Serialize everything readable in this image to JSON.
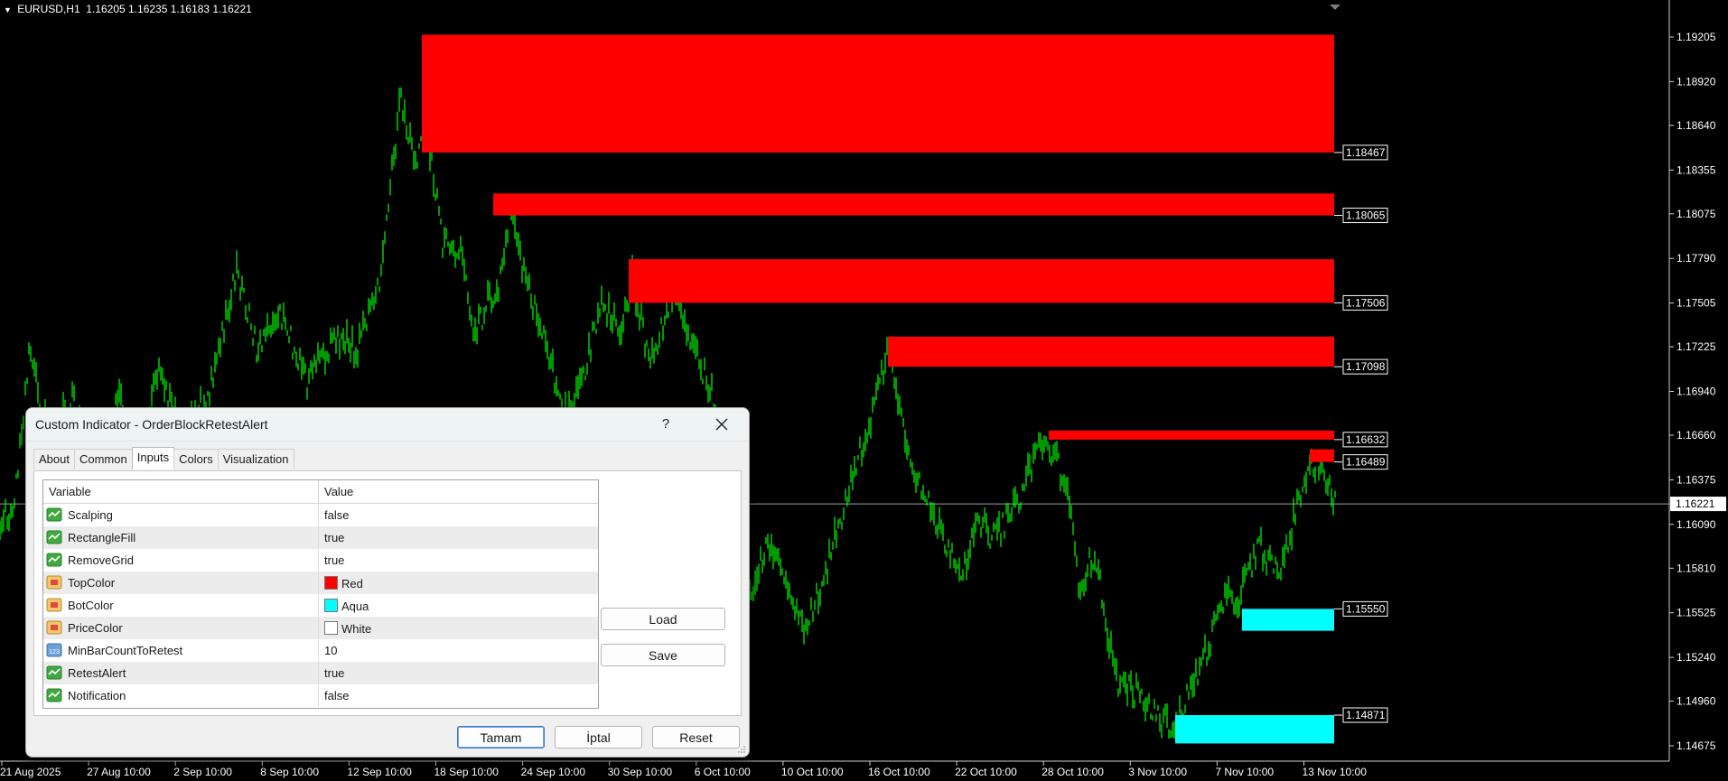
{
  "chart": {
    "symbol": "EURUSD,H1",
    "ohlc": "1.16205 1.16235 1.16183 1.16221",
    "current_price": "1.16221",
    "price_axis": [
      "1.19205",
      "1.18920",
      "1.18640",
      "1.18355",
      "1.18075",
      "1.17790",
      "1.17505",
      "1.17225",
      "1.16940",
      "1.16660",
      "1.16375",
      "1.16090",
      "1.15810",
      "1.15525",
      "1.15240",
      "1.14960",
      "1.14675"
    ],
    "time_axis": [
      "21 Aug 2025",
      "27 Aug 10:00",
      "2 Sep 10:00",
      "8 Sep 10:00",
      "12 Sep 10:00",
      "18 Sep 10:00",
      "24 Sep 10:00",
      "30 Sep 10:00",
      "6 Oct 10:00",
      "10 Oct 10:00",
      "16 Oct 10:00",
      "22 Oct 10:00",
      "28 Oct 10:00",
      "3 Nov 10:00",
      "7 Nov 10:00",
      "13 Nov 10:00"
    ],
    "order_blocks": [
      {
        "kind": "top",
        "upper": 1.1922,
        "lower": 1.18467,
        "label": "1.18467"
      },
      {
        "kind": "top",
        "upper": 1.18205,
        "lower": 1.18065,
        "label": "1.18065"
      },
      {
        "kind": "top",
        "upper": 1.17785,
        "lower": 1.17506,
        "label": "1.17506"
      },
      {
        "kind": "top",
        "upper": 1.1729,
        "lower": 1.17098,
        "label": "1.17098"
      },
      {
        "kind": "top",
        "upper": 1.1669,
        "lower": 1.16632,
        "label": "1.16632"
      },
      {
        "kind": "top",
        "upper": 1.1657,
        "lower": 1.16489,
        "label": "1.16489"
      },
      {
        "kind": "bottom",
        "upper": 1.1555,
        "lower": 1.1541,
        "label": "1.15550"
      },
      {
        "kind": "bottom",
        "upper": 1.14871,
        "lower": 1.1469,
        "label": "1.14871"
      }
    ],
    "colors": {
      "background": "#000000",
      "candles": "#00ff00",
      "top_block": "#ff0000",
      "bottom_block": "#00ffff",
      "axis_text": "#ffffff",
      "price_line": "#9aa0a6"
    }
  },
  "dialog": {
    "title": "Custom Indicator - OrderBlockRetestAlert",
    "help": "?",
    "tabs": [
      {
        "label": "About",
        "active": false
      },
      {
        "label": "Common",
        "active": false
      },
      {
        "label": "Inputs",
        "active": true
      },
      {
        "label": "Colors",
        "active": false
      },
      {
        "label": "Visualization",
        "active": false
      }
    ],
    "table": {
      "col_variable": "Variable",
      "col_value": "Value",
      "rows": [
        {
          "icon": "bool",
          "name": "Scalping",
          "value": "false"
        },
        {
          "icon": "bool",
          "name": "RectangleFill",
          "value": "true"
        },
        {
          "icon": "bool",
          "name": "RemoveGrid",
          "value": "true"
        },
        {
          "icon": "color",
          "name": "TopColor",
          "value": "Red",
          "swatch": "#ff0000"
        },
        {
          "icon": "color",
          "name": "BotColor",
          "value": "Aqua",
          "swatch": "#00ffff"
        },
        {
          "icon": "color",
          "name": "PriceColor",
          "value": "White",
          "swatch": "#ffffff"
        },
        {
          "icon": "int",
          "name": "MinBarCountToRetest",
          "value": "10"
        },
        {
          "icon": "bool",
          "name": "RetestAlert",
          "value": "true"
        },
        {
          "icon": "bool",
          "name": "Notification",
          "value": "false"
        }
      ]
    },
    "buttons": {
      "load": "Load",
      "save": "Save",
      "ok": "Tamam",
      "cancel": "İptal",
      "reset": "Reset"
    }
  }
}
